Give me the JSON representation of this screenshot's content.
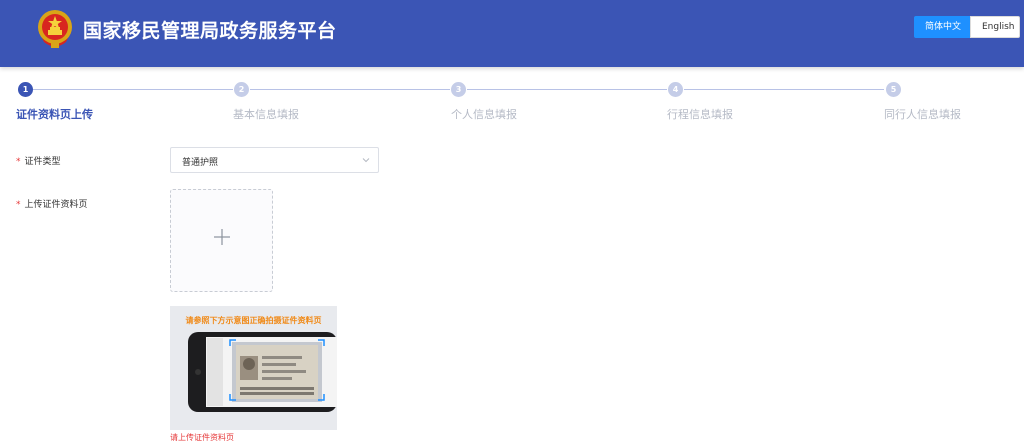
{
  "header": {
    "title": "国家移民管理局政务服务平台",
    "emblem_icon": "national-emblem-icon",
    "language": {
      "active": "简体中文",
      "other": "English"
    },
    "colors": {
      "background": "#3b55b5",
      "lang_active": "#1e90ff"
    }
  },
  "steps": [
    {
      "number": "1",
      "label": "证件资料页上传",
      "state": "active"
    },
    {
      "number": "2",
      "label": "基本信息填报",
      "state": "pending"
    },
    {
      "number": "3",
      "label": "个人信息填报",
      "state": "pending"
    },
    {
      "number": "4",
      "label": "行程信息填报",
      "state": "pending"
    },
    {
      "number": "5",
      "label": "同行人信息填报",
      "state": "pending"
    }
  ],
  "form": {
    "required_mark": "*",
    "doc_type": {
      "label": "证件类型",
      "value": "普通护照",
      "arrow_icon": "chevron-down-icon"
    },
    "upload": {
      "label": "上传证件资料页",
      "icon": "plus-icon",
      "sample_tip": "请参照下方示意图正确拍摄证件资料页",
      "error": "请上传证件资料页"
    }
  }
}
